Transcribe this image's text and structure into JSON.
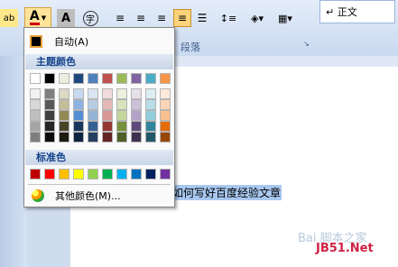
{
  "toolbar": {
    "highlight_label": "ab",
    "font_color_label": "A",
    "char_shade_label": "A",
    "enclose_label": "字",
    "group_paragraph": "段落",
    "style_normal": "↵ 正文"
  },
  "menu": {
    "auto": "自动(A)",
    "theme_header": "主题颜色",
    "standard_header": "标准色",
    "more": "其他颜色(M)...",
    "theme_top": [
      "#ffffff",
      "#000000",
      "#eeece1",
      "#1f497d",
      "#4f81bd",
      "#c0504d",
      "#9bbb59",
      "#8064a2",
      "#4bacc6",
      "#f79646"
    ],
    "theme_shades": [
      [
        "#f2f2f2",
        "#7f7f7f",
        "#ddd9c3",
        "#c6d9f0",
        "#dbe5f1",
        "#f2dcdb",
        "#ebf1dd",
        "#e5e0ec",
        "#dbeef3",
        "#fdeada"
      ],
      [
        "#d8d8d8",
        "#595959",
        "#c4bd97",
        "#8db3e2",
        "#b8cce4",
        "#e5b9b7",
        "#d7e3bc",
        "#ccc1d9",
        "#b7dde8",
        "#fbd5b5"
      ],
      [
        "#bfbfbf",
        "#3f3f3f",
        "#938953",
        "#548dd4",
        "#95b3d7",
        "#d99694",
        "#c3d69b",
        "#b2a2c7",
        "#92cddc",
        "#fac08f"
      ],
      [
        "#a5a5a5",
        "#262626",
        "#494429",
        "#17365d",
        "#366092",
        "#953734",
        "#76923c",
        "#5f497a",
        "#31859b",
        "#e36c09"
      ],
      [
        "#7f7f7f",
        "#0c0c0c",
        "#1d1b10",
        "#0f243e",
        "#244061",
        "#632423",
        "#4f6128",
        "#3f3151",
        "#205867",
        "#974806"
      ]
    ],
    "standard": [
      "#c00000",
      "#ff0000",
      "#ffc000",
      "#ffff00",
      "#92d050",
      "#00b050",
      "#00b0f0",
      "#0070c0",
      "#002060",
      "#7030a0"
    ]
  },
  "document": {
    "text": "如何写好百度经验文章"
  },
  "watermark": {
    "line1": "Bai 脚本之家",
    "line2": "JB51.Net"
  }
}
